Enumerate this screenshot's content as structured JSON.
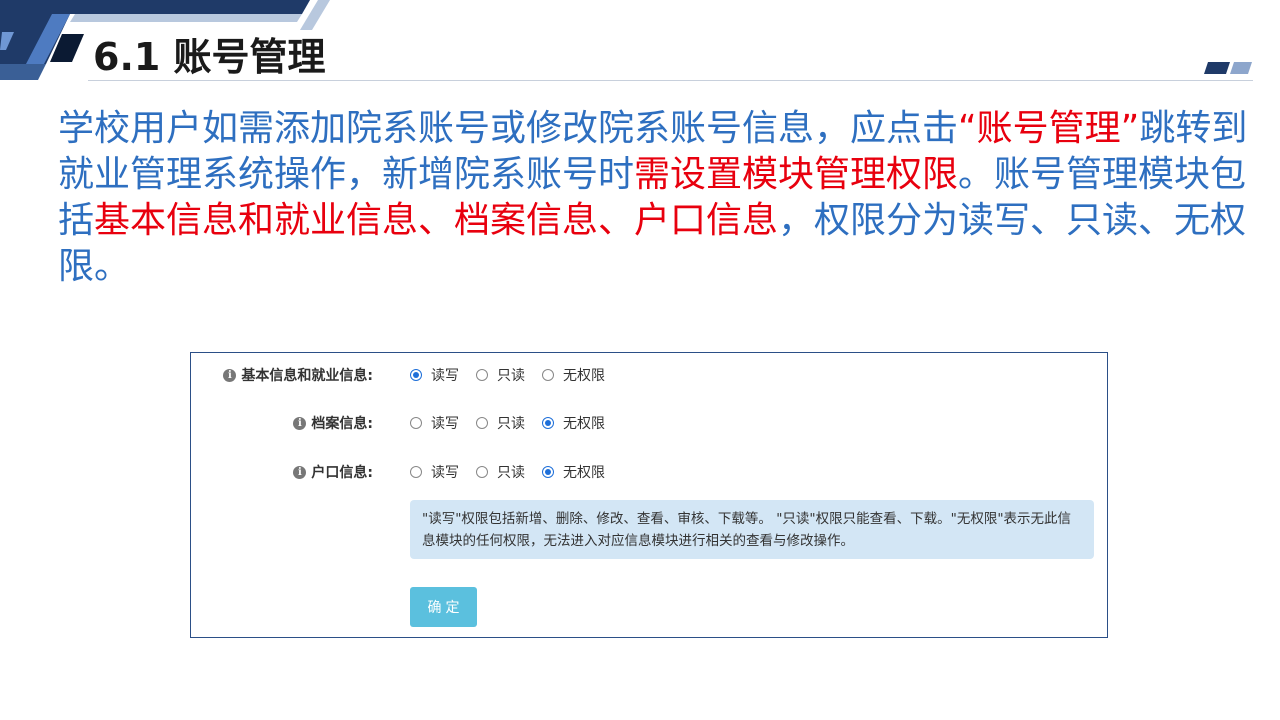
{
  "header": {
    "title": "6.1 账号管理"
  },
  "body": {
    "seg1": "学校用户如需添加院系账号或修改院系账号信息，应点击",
    "seg2": "“账号管理”",
    "seg3": "跳转到就业管理系统操作，新增院系账号时",
    "seg4": "需设置模块管理权限",
    "seg5": "。账号管理模块包括",
    "seg6": "基本信息和就业信息、档案信息、户口信息",
    "seg7": "，权限分为读写、只读、无权限。"
  },
  "form": {
    "rows": [
      {
        "label": "基本信息和就业信息:",
        "selected": "读写"
      },
      {
        "label": "档案信息:",
        "selected": "无权限"
      },
      {
        "label": "户口信息:",
        "selected": "无权限"
      }
    ],
    "options": [
      "读写",
      "只读",
      "无权限"
    ],
    "notice": "\"读写\"权限包括新增、删除、修改、查看、审核、下载等。 \"只读\"权限只能查看、下载。\"无权限\"表示无此信息模块的任何权限，无法进入对应信息模块进行相关的查看与修改操作。",
    "confirm_label": "确定"
  },
  "colors": {
    "body_text": "#2e6fc0",
    "highlight": "#e8000e",
    "panel_border": "#2b4f87",
    "notice_bg": "#d3e6f5",
    "button": "#5bc0de",
    "radio_selected": "#1e6fd9"
  }
}
